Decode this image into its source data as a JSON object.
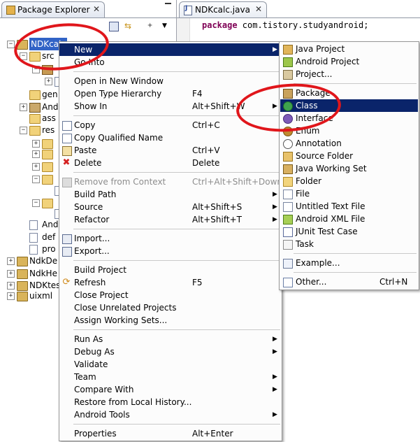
{
  "explorer": {
    "tab_label": "Package Explorer",
    "close_glyph": "✕",
    "tree": [
      {
        "label": "NDKcalc",
        "indent": 0,
        "icon": "project",
        "expander": "−",
        "selected": true
      },
      {
        "label": "src",
        "indent": 1,
        "icon": "folder",
        "expander": "−"
      },
      {
        "label": "",
        "indent": 2,
        "icon": "pkg",
        "expander": "−"
      },
      {
        "label": "",
        "indent": 3,
        "icon": "file",
        "expander": "+"
      },
      {
        "label": "gen",
        "indent": 1,
        "icon": "folder",
        "expander": ""
      },
      {
        "label": "And",
        "indent": 1,
        "icon": "lib",
        "expander": "+"
      },
      {
        "label": "ass",
        "indent": 1,
        "icon": "folder",
        "expander": ""
      },
      {
        "label": "res",
        "indent": 1,
        "icon": "folder",
        "expander": "−"
      },
      {
        "label": "",
        "indent": 2,
        "icon": "folder",
        "expander": "+"
      },
      {
        "label": "",
        "indent": 2,
        "icon": "folder",
        "expander": "+"
      },
      {
        "label": "",
        "indent": 2,
        "icon": "folder",
        "expander": "+"
      },
      {
        "label": "",
        "indent": 2,
        "icon": "folder",
        "expander": "−"
      },
      {
        "label": "",
        "indent": 3,
        "icon": "file",
        "expander": ""
      },
      {
        "label": "",
        "indent": 2,
        "icon": "folder",
        "expander": "−"
      },
      {
        "label": "",
        "indent": 3,
        "icon": "file",
        "expander": ""
      },
      {
        "label": "And",
        "indent": 1,
        "icon": "file",
        "expander": ""
      },
      {
        "label": "def",
        "indent": 1,
        "icon": "file",
        "expander": ""
      },
      {
        "label": "pro",
        "indent": 1,
        "icon": "file",
        "expander": ""
      },
      {
        "label": "NdkDe",
        "indent": 0,
        "icon": "project",
        "expander": "+"
      },
      {
        "label": "NdkHe",
        "indent": 0,
        "icon": "project",
        "expander": "+"
      },
      {
        "label": "NDKtes",
        "indent": 0,
        "icon": "project",
        "expander": "+"
      },
      {
        "label": "uixml",
        "indent": 0,
        "icon": "project",
        "expander": "+"
      }
    ]
  },
  "editor": {
    "tab_label": "NDKcalc.java",
    "close_glyph": "✕",
    "code_keyword": "package",
    "code_rest": " com.tistory.studyandroid;"
  },
  "context_menu": {
    "items": [
      {
        "label": "New",
        "shortcut": "",
        "submenu": true,
        "highlighted": true,
        "icon": ""
      },
      {
        "label": "Go Into",
        "shortcut": "",
        "submenu": false,
        "icon": ""
      },
      {
        "sep": true
      },
      {
        "label": "Open in New Window",
        "shortcut": "",
        "submenu": false,
        "icon": ""
      },
      {
        "label": "Open Type Hierarchy",
        "shortcut": "F4",
        "submenu": false,
        "icon": ""
      },
      {
        "label": "Show In",
        "shortcut": "Alt+Shift+W",
        "submenu": true,
        "icon": ""
      },
      {
        "sep": true
      },
      {
        "label": "Copy",
        "shortcut": "Ctrl+C",
        "submenu": false,
        "icon": "i-copy"
      },
      {
        "label": "Copy Qualified Name",
        "shortcut": "",
        "submenu": false,
        "icon": "i-copy"
      },
      {
        "label": "Paste",
        "shortcut": "Ctrl+V",
        "submenu": false,
        "icon": "i-paste"
      },
      {
        "label": "Delete",
        "shortcut": "Delete",
        "submenu": false,
        "icon": "i-delete"
      },
      {
        "sep": true
      },
      {
        "label": "Remove from Context",
        "shortcut": "Ctrl+Alt+Shift+Down",
        "submenu": false,
        "disabled": true,
        "icon": "i-remove"
      },
      {
        "label": "Build Path",
        "shortcut": "",
        "submenu": true,
        "icon": ""
      },
      {
        "label": "Source",
        "shortcut": "Alt+Shift+S",
        "submenu": true,
        "icon": ""
      },
      {
        "label": "Refactor",
        "shortcut": "Alt+Shift+T",
        "submenu": true,
        "icon": ""
      },
      {
        "sep": true
      },
      {
        "label": "Import...",
        "shortcut": "",
        "submenu": false,
        "icon": "i-import"
      },
      {
        "label": "Export...",
        "shortcut": "",
        "submenu": false,
        "icon": "i-export"
      },
      {
        "sep": true
      },
      {
        "label": "Build Project",
        "shortcut": "",
        "submenu": false,
        "icon": ""
      },
      {
        "label": "Refresh",
        "shortcut": "F5",
        "submenu": false,
        "icon": "i-refresh"
      },
      {
        "label": "Close Project",
        "shortcut": "",
        "submenu": false,
        "icon": ""
      },
      {
        "label": "Close Unrelated Projects",
        "shortcut": "",
        "submenu": false,
        "icon": ""
      },
      {
        "label": "Assign Working Sets...",
        "shortcut": "",
        "submenu": false,
        "icon": ""
      },
      {
        "sep": true
      },
      {
        "label": "Run As",
        "shortcut": "",
        "submenu": true,
        "icon": ""
      },
      {
        "label": "Debug As",
        "shortcut": "",
        "submenu": true,
        "icon": ""
      },
      {
        "label": "Validate",
        "shortcut": "",
        "submenu": false,
        "icon": ""
      },
      {
        "label": "Team",
        "shortcut": "",
        "submenu": true,
        "icon": ""
      },
      {
        "label": "Compare With",
        "shortcut": "",
        "submenu": true,
        "icon": ""
      },
      {
        "label": "Restore from Local History...",
        "shortcut": "",
        "submenu": false,
        "icon": ""
      },
      {
        "label": "Android Tools",
        "shortcut": "",
        "submenu": true,
        "icon": ""
      },
      {
        "sep": true
      },
      {
        "label": "Properties",
        "shortcut": "Alt+Enter",
        "submenu": false,
        "icon": ""
      }
    ]
  },
  "new_submenu": {
    "items": [
      {
        "label": "Java Project",
        "shortcut": "",
        "icon": "i-jproj"
      },
      {
        "label": "Android Project",
        "shortcut": "",
        "icon": "i-aproj"
      },
      {
        "label": "Project...",
        "shortcut": "",
        "icon": "i-proj"
      },
      {
        "sep": true
      },
      {
        "label": "Package",
        "shortcut": "",
        "icon": "i-pkg"
      },
      {
        "label": "Class",
        "shortcut": "",
        "icon": "i-class",
        "highlighted": true
      },
      {
        "label": "Interface",
        "shortcut": "",
        "icon": "i-iface"
      },
      {
        "label": "Enum",
        "shortcut": "",
        "icon": "i-enum"
      },
      {
        "label": "Annotation",
        "shortcut": "",
        "icon": "i-annot"
      },
      {
        "label": "Source Folder",
        "shortcut": "",
        "icon": "i-srcf"
      },
      {
        "label": "Java Working Set",
        "shortcut": "",
        "icon": "i-jws"
      },
      {
        "label": "Folder",
        "shortcut": "",
        "icon": "i-folder"
      },
      {
        "label": "File",
        "shortcut": "",
        "icon": "i-file"
      },
      {
        "label": "Untitled Text File",
        "shortcut": "",
        "icon": "i-utf"
      },
      {
        "label": "Android XML File",
        "shortcut": "",
        "icon": "i-axml"
      },
      {
        "label": "JUnit Test Case",
        "shortcut": "",
        "icon": "i-junit"
      },
      {
        "label": "Task",
        "shortcut": "",
        "icon": "i-task"
      },
      {
        "sep": true
      },
      {
        "label": "Example...",
        "shortcut": "",
        "icon": "i-example"
      },
      {
        "sep": true
      },
      {
        "label": "Other...",
        "shortcut": "Ctrl+N",
        "icon": "i-other"
      }
    ]
  },
  "colors": {
    "menu_highlight": "#0a246a",
    "tree_selection": "#3163c6",
    "annotation_red": "#e0161b",
    "keyword": "#7f0055"
  }
}
